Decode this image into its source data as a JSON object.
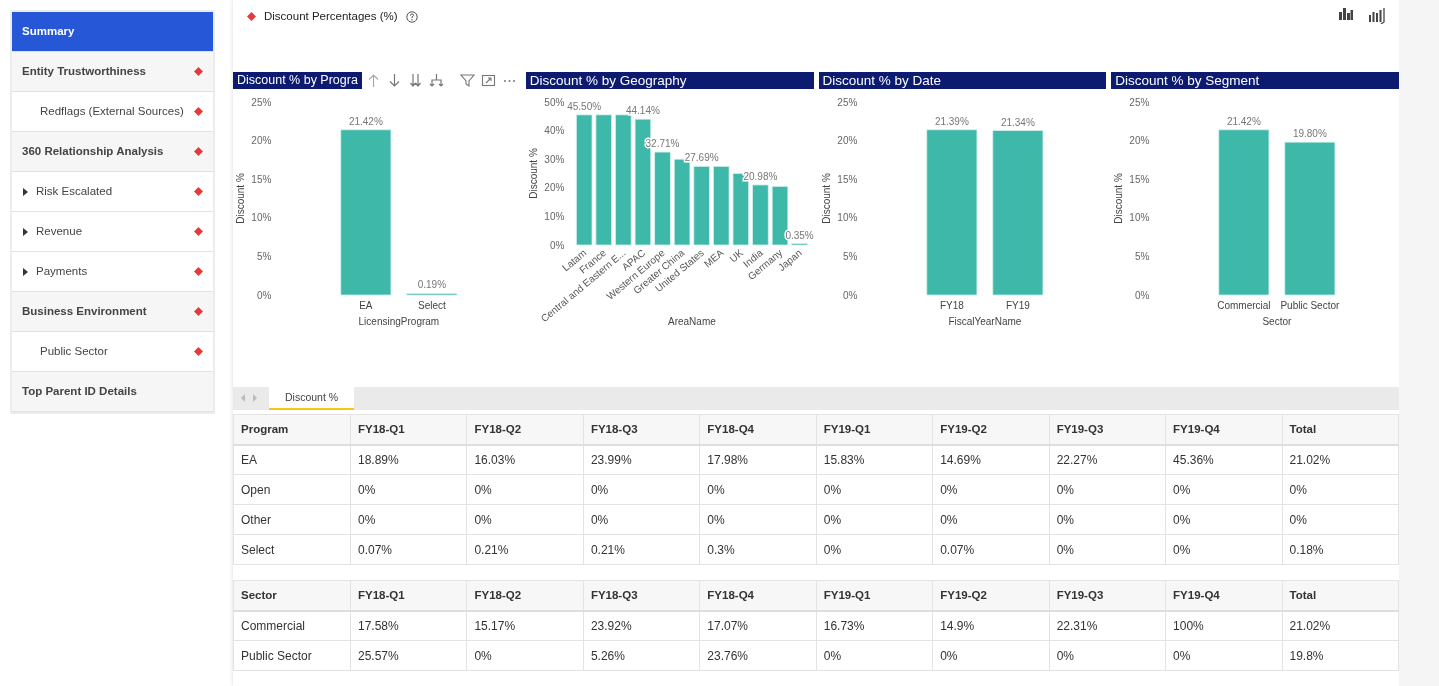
{
  "sidebar": {
    "items": [
      {
        "label": "Summary",
        "selected": true,
        "flagged": false
      },
      {
        "label": "Entity Trustworthiness",
        "selected": false,
        "flagged": true,
        "children": [
          {
            "label": "Redflags (External Sources)",
            "selected": false,
            "flagged": true
          }
        ]
      },
      {
        "label": "360 Relationship Analysis",
        "selected": false,
        "flagged": true,
        "children": [
          {
            "label": "Risk Escalated",
            "selected": false,
            "flagged": true,
            "expanded": false
          },
          {
            "label": "Revenue",
            "selected": false,
            "flagged": true,
            "expanded": false
          },
          {
            "label": "Payments",
            "selected": false,
            "flagged": true,
            "expanded": false
          }
        ]
      },
      {
        "label": "Business Environment",
        "selected": false,
        "flagged": true,
        "children": [
          {
            "label": "Public Sector",
            "selected": false,
            "flagged": true
          }
        ]
      },
      {
        "label": "Top Parent ID Details",
        "selected": false,
        "flagged": false
      }
    ]
  },
  "page": {
    "title": "Discount Percentages (%)",
    "flagged": true
  },
  "charts": [
    {
      "title": "Discount % by Progra",
      "hover_toolbar": true,
      "chart_data": {
        "type": "bar",
        "xlabel": "LicensingProgram",
        "ylabel": "Discount %",
        "categories": [
          "EA",
          "Select"
        ],
        "series": [
          {
            "color": "#3db8a9",
            "values": [
              21.4,
              0.2
            ]
          }
        ],
        "ylim": [
          0,
          25
        ],
        "yticks": [
          {
            "value": 0,
            "label": "0%"
          },
          {
            "value": 5,
            "label": "5%"
          },
          {
            "value": 10,
            "label": "10%"
          },
          {
            "value": 15,
            "label": "15%"
          },
          {
            "value": 20,
            "label": "20%"
          },
          {
            "value": 25,
            "label": "25%"
          }
        ],
        "value_labels": [
          "21.42%",
          "0.19%"
        ]
      }
    },
    {
      "title": "Discount % by Geography",
      "chart_data": {
        "type": "bar",
        "xlabel": "AreaName",
        "ylabel": "Discount %",
        "categories": [
          "Latam",
          "France",
          "Central and Eastern E...",
          "APAC",
          "Western Europe",
          "Greater China",
          "United States",
          "MEA",
          "UK",
          "India",
          "Germany",
          "Japan"
        ],
        "series": [
          {
            "color": "#3db8a9",
            "values": [
              45.5,
              45.5,
              45.5,
              44,
              32.5,
              30,
              27.5,
              27.5,
              25,
              21,
              20.5,
              0.5
            ]
          }
        ],
        "ylim": [
          0,
          50
        ],
        "yticks": [
          {
            "value": 0,
            "label": "0%"
          },
          {
            "value": 10,
            "label": "10%"
          },
          {
            "value": 20,
            "label": "20%"
          },
          {
            "value": 30,
            "label": "30%"
          },
          {
            "value": 40,
            "label": "40%"
          },
          {
            "value": 50,
            "label": "50%"
          }
        ],
        "value_labels": [
          "45.50%",
          null,
          null,
          "44.14%",
          "32.71%",
          null,
          "27.69%",
          null,
          null,
          "20.98%",
          null,
          "0.35%"
        ]
      }
    },
    {
      "title": "Discount % by Date",
      "chart_data": {
        "type": "bar",
        "xlabel": "FiscalYearName",
        "ylabel": "Discount %",
        "categories": [
          "FY18",
          "FY19"
        ],
        "series": [
          {
            "color": "#3db8a9",
            "values": [
              21.4,
              21.3
            ]
          }
        ],
        "ylim": [
          0,
          25
        ],
        "yticks": [
          {
            "value": 0,
            "label": "0%"
          },
          {
            "value": 5,
            "label": "5%"
          },
          {
            "value": 10,
            "label": "10%"
          },
          {
            "value": 15,
            "label": "15%"
          },
          {
            "value": 20,
            "label": "20%"
          },
          {
            "value": 25,
            "label": "25%"
          }
        ],
        "value_labels": [
          "21.39%",
          "21.34%"
        ]
      }
    },
    {
      "title": "Discount % by Segment",
      "chart_data": {
        "type": "bar",
        "xlabel": "Sector",
        "ylabel": "Discount %",
        "categories": [
          "Commercial",
          "Public Sector"
        ],
        "series": [
          {
            "color": "#3db8a9",
            "values": [
              21.4,
              19.8
            ]
          }
        ],
        "ylim": [
          0,
          25
        ],
        "yticks": [
          {
            "value": 0,
            "label": "0%"
          },
          {
            "value": 5,
            "label": "5%"
          },
          {
            "value": 10,
            "label": "10%"
          },
          {
            "value": 15,
            "label": "15%"
          },
          {
            "value": 20,
            "label": "20%"
          },
          {
            "value": 25,
            "label": "25%"
          }
        ],
        "value_labels": [
          "21.42%",
          "19.80%"
        ]
      }
    }
  ],
  "tabs": [
    {
      "label": "Discount %",
      "selected": true
    }
  ],
  "tables": [
    {
      "columns": [
        "Program",
        "FY18-Q1",
        "FY18-Q2",
        "FY18-Q3",
        "FY18-Q4",
        "FY19-Q1",
        "FY19-Q2",
        "FY19-Q3",
        "FY19-Q4",
        "Total"
      ],
      "rows": [
        [
          "EA",
          "18.89%",
          "16.03%",
          "23.99%",
          "17.98%",
          "15.83%",
          "14.69%",
          "22.27%",
          "45.36%",
          "21.02%"
        ],
        [
          "Open",
          "0%",
          "0%",
          "0%",
          "0%",
          "0%",
          "0%",
          "0%",
          "0%",
          "0%"
        ],
        [
          "Other",
          "0%",
          "0%",
          "0%",
          "0%",
          "0%",
          "0%",
          "0%",
          "0%",
          "0%"
        ],
        [
          "Select",
          "0.07%",
          "0.21%",
          "0.21%",
          "0.3%",
          "0%",
          "0.07%",
          "0%",
          "0%",
          "0.18%"
        ]
      ]
    },
    {
      "columns": [
        "Sector",
        "FY18-Q1",
        "FY18-Q2",
        "FY18-Q3",
        "FY18-Q4",
        "FY19-Q1",
        "FY19-Q2",
        "FY19-Q3",
        "FY19-Q4",
        "Total"
      ],
      "rows": [
        [
          "Commercial",
          "17.58%",
          "15.17%",
          "23.92%",
          "17.07%",
          "16.73%",
          "14.9%",
          "22.31%",
          "100%",
          "21.02%"
        ],
        [
          "Public Sector",
          "25.57%",
          "0%",
          "5.26%",
          "23.76%",
          "0%",
          "0%",
          "0%",
          "0%",
          "19.8%"
        ]
      ]
    }
  ]
}
